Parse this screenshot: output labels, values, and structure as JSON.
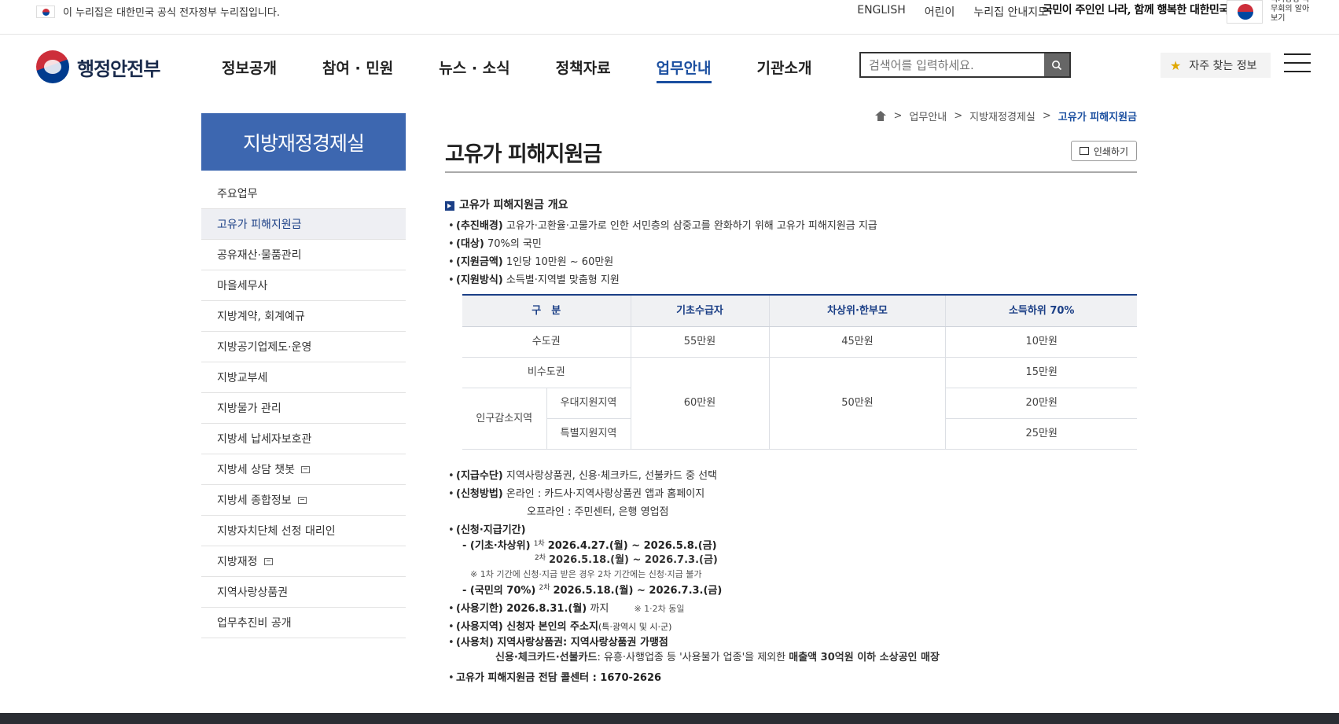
{
  "topbar": {
    "notice": "이 누리집은 대한민국 공식 전자정부 누리집입니다.",
    "links": [
      "ENGLISH",
      "어린이",
      "누리집 안내지도"
    ],
    "slogan": "국민이 주인인 나라, 함께 행복한 대한민국",
    "gov_tag": "국가상징 국무회의 알아보기"
  },
  "header": {
    "logo": "행정안전부",
    "nav": [
      "정보공개",
      "참여 · 민원",
      "뉴스 · 소식",
      "정책자료",
      "업무안내",
      "기관소개"
    ],
    "active_nav": "업무안내",
    "search_placeholder": "검색어를 입력하세요.",
    "freq_label": "자주 찾는 정보"
  },
  "lnb": {
    "title": "지방재정경제실",
    "items": [
      {
        "label": "주요업무",
        "active": false,
        "external": false
      },
      {
        "label": "고유가 피해지원금",
        "active": true,
        "external": false
      },
      {
        "label": "공유재산·물품관리",
        "active": false,
        "external": false
      },
      {
        "label": "마을세무사",
        "active": false,
        "external": false
      },
      {
        "label": "지방계약, 회계예규",
        "active": false,
        "external": false
      },
      {
        "label": "지방공기업제도·운영",
        "active": false,
        "external": false
      },
      {
        "label": "지방교부세",
        "active": false,
        "external": false
      },
      {
        "label": "지방물가 관리",
        "active": false,
        "external": false
      },
      {
        "label": "지방세 납세자보호관",
        "active": false,
        "external": false
      },
      {
        "label": "지방세 상담 챗봇",
        "active": false,
        "external": true
      },
      {
        "label": "지방세 종합정보",
        "active": false,
        "external": true
      },
      {
        "label": "지방자치단체 선정 대리인",
        "active": false,
        "external": false
      },
      {
        "label": "지방재정",
        "active": false,
        "external": true
      },
      {
        "label": "지역사랑상품권",
        "active": false,
        "external": false
      },
      {
        "label": "업무추진비 공개",
        "active": false,
        "external": false
      }
    ]
  },
  "breadcrumb": [
    "업무안내",
    "지방재정경제실",
    "고유가 피해지원금"
  ],
  "breadcrumb_sep": ">",
  "page": {
    "title": "고유가 피해지원금",
    "print_label": "인쇄하기",
    "section_title": "고유가 피해지원금 개요",
    "items1": [
      {
        "label": "(추진배경)",
        "text": " 고유가·고환율·고물가로 인한 서민층의 삼중고를 완화하기 위해 고유가 피해지원금 지급"
      },
      {
        "label": "(대상)",
        "text": " 70%의 국민"
      },
      {
        "label": "(지원금액)",
        "text": " 1인당 10만원 ~ 60만원"
      },
      {
        "label": "(지원방식)",
        "text": " 소득별·지역별 맞춤형 지원"
      }
    ],
    "table": {
      "headers": [
        "구　분",
        "기초수급자",
        "차상위·한부모",
        "소득하위 70%"
      ],
      "r1": [
        "수도권",
        "55만원",
        "45만원",
        "10만원"
      ],
      "r2_label": "비수도권",
      "merged_a": "60만원",
      "merged_b": "50만원",
      "r2_c": "15만원",
      "r3_group": "인구감소지역",
      "r3_sub": "우대지원지역",
      "r3_c": "20만원",
      "r4_sub": "특별지원지역",
      "r4_c": "25만원"
    },
    "pay": {
      "label": "(지급수단)",
      "text": " 지역사랑상품권, 신용·체크카드, 선불카드 중 선택"
    },
    "apply": {
      "label": "(신청방법)",
      "text": " 온라인 : 카드사·지역사랑상품권 앱과 홈페이지",
      "offline": "오프라인 : 주민센터, 은행 영업점"
    },
    "period_label": "(신청·지급기간)",
    "basic_label": "- (기초·차상위)",
    "round1": "1차",
    "round1_date": "2026.4.27.(월) ~ 2026.5.8.(금)",
    "round2": "2차",
    "round2_date": "2026.5.18.(월) ~ 2026.7.3.(금)",
    "period_note": "※ 1차 기간에 신청·지급 받은 경우 2차 기간에는 신청·지급 불가",
    "public_label": "- (국민의 70%)",
    "public_round": "2차",
    "public_date": "2026.5.18.(월) ~ 2026.7.3.(금)",
    "use_period_label": "(사용기한) 2026.8.31.(월)",
    "use_period_text": " 까지",
    "use_period_note": "※ 1·2차 동일",
    "use_area_label": "(사용지역) 신청자 본인의 주소지",
    "use_area_text": "(특·광역시 및 시·군)",
    "use_place_label": "(사용처) 지역사랑상품권: 지역사랑상품권 가맹점",
    "use_place_card_label": "신용·체크카드·선불카드",
    "use_place_card_text": ": 유흥·사행업종 등 '사용불가 업종'을 제외한 ",
    "use_place_card_bold": "매출액 30억원 이하 소상공인 매장",
    "callcenter": "고유가 피해지원금 전담 콜센터 : 1670-2626"
  }
}
